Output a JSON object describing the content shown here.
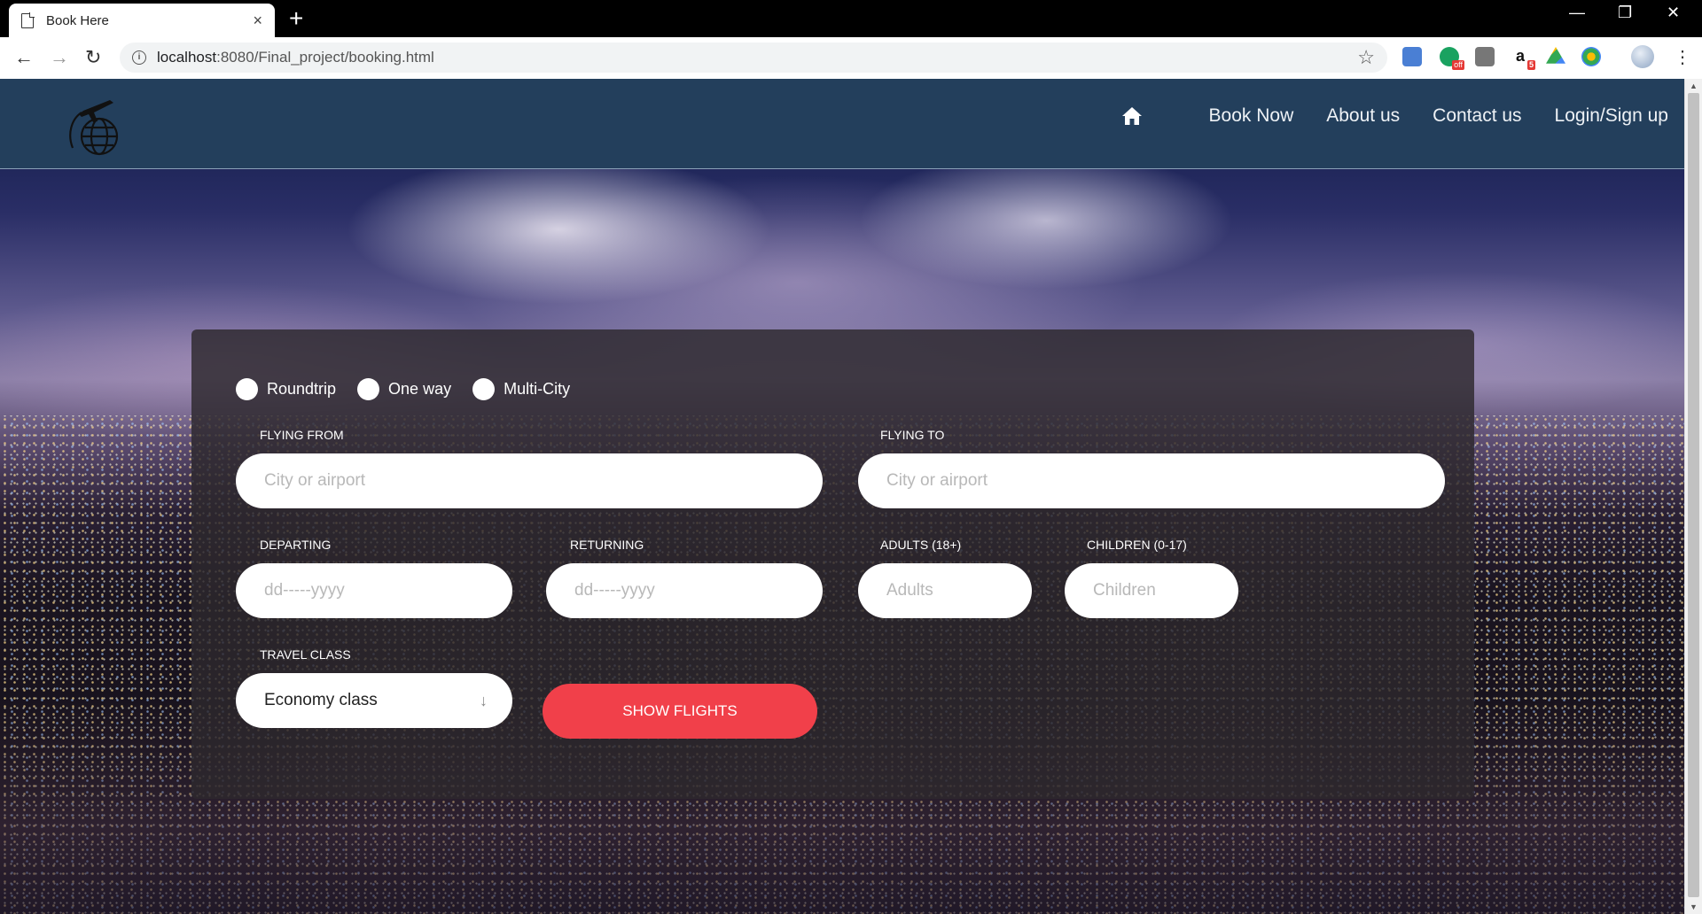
{
  "browser": {
    "tab_title": "Book Here",
    "tab_close": "×",
    "new_tab": "+",
    "url_host": "localhost",
    "url_rest": ":8080/Final_project/booking.html",
    "ext_badge_off": "off",
    "ext_badge_count": "5",
    "controls": {
      "minimize": "—",
      "restore": "❐",
      "close": "✕"
    }
  },
  "site": {
    "nav": {
      "home_icon": "home-icon",
      "links": [
        "Book Now",
        "About us",
        "Contact us",
        "Login/Sign up"
      ]
    }
  },
  "booking": {
    "trip_types": [
      "Roundtrip",
      "One way",
      "Multi-City"
    ],
    "flying_from": {
      "label": "Flying from",
      "placeholder": "City or airport"
    },
    "flying_to": {
      "label": "Flying to",
      "placeholder": "City or airport"
    },
    "departing": {
      "label": "Departing",
      "placeholder": "dd-----yyyy"
    },
    "returning": {
      "label": "Returning",
      "placeholder": "dd-----yyyy"
    },
    "adults": {
      "label": "Adults (18+)",
      "placeholder": "Adults"
    },
    "children": {
      "label": "Children (0-17)",
      "placeholder": "Children"
    },
    "travel_class": {
      "label": "Travel class",
      "value": "Economy class"
    },
    "submit_label": "Show flights"
  },
  "colors": {
    "navbar": "#233f5c",
    "form_bg": "#2d282d",
    "submit": "#f1404a"
  }
}
